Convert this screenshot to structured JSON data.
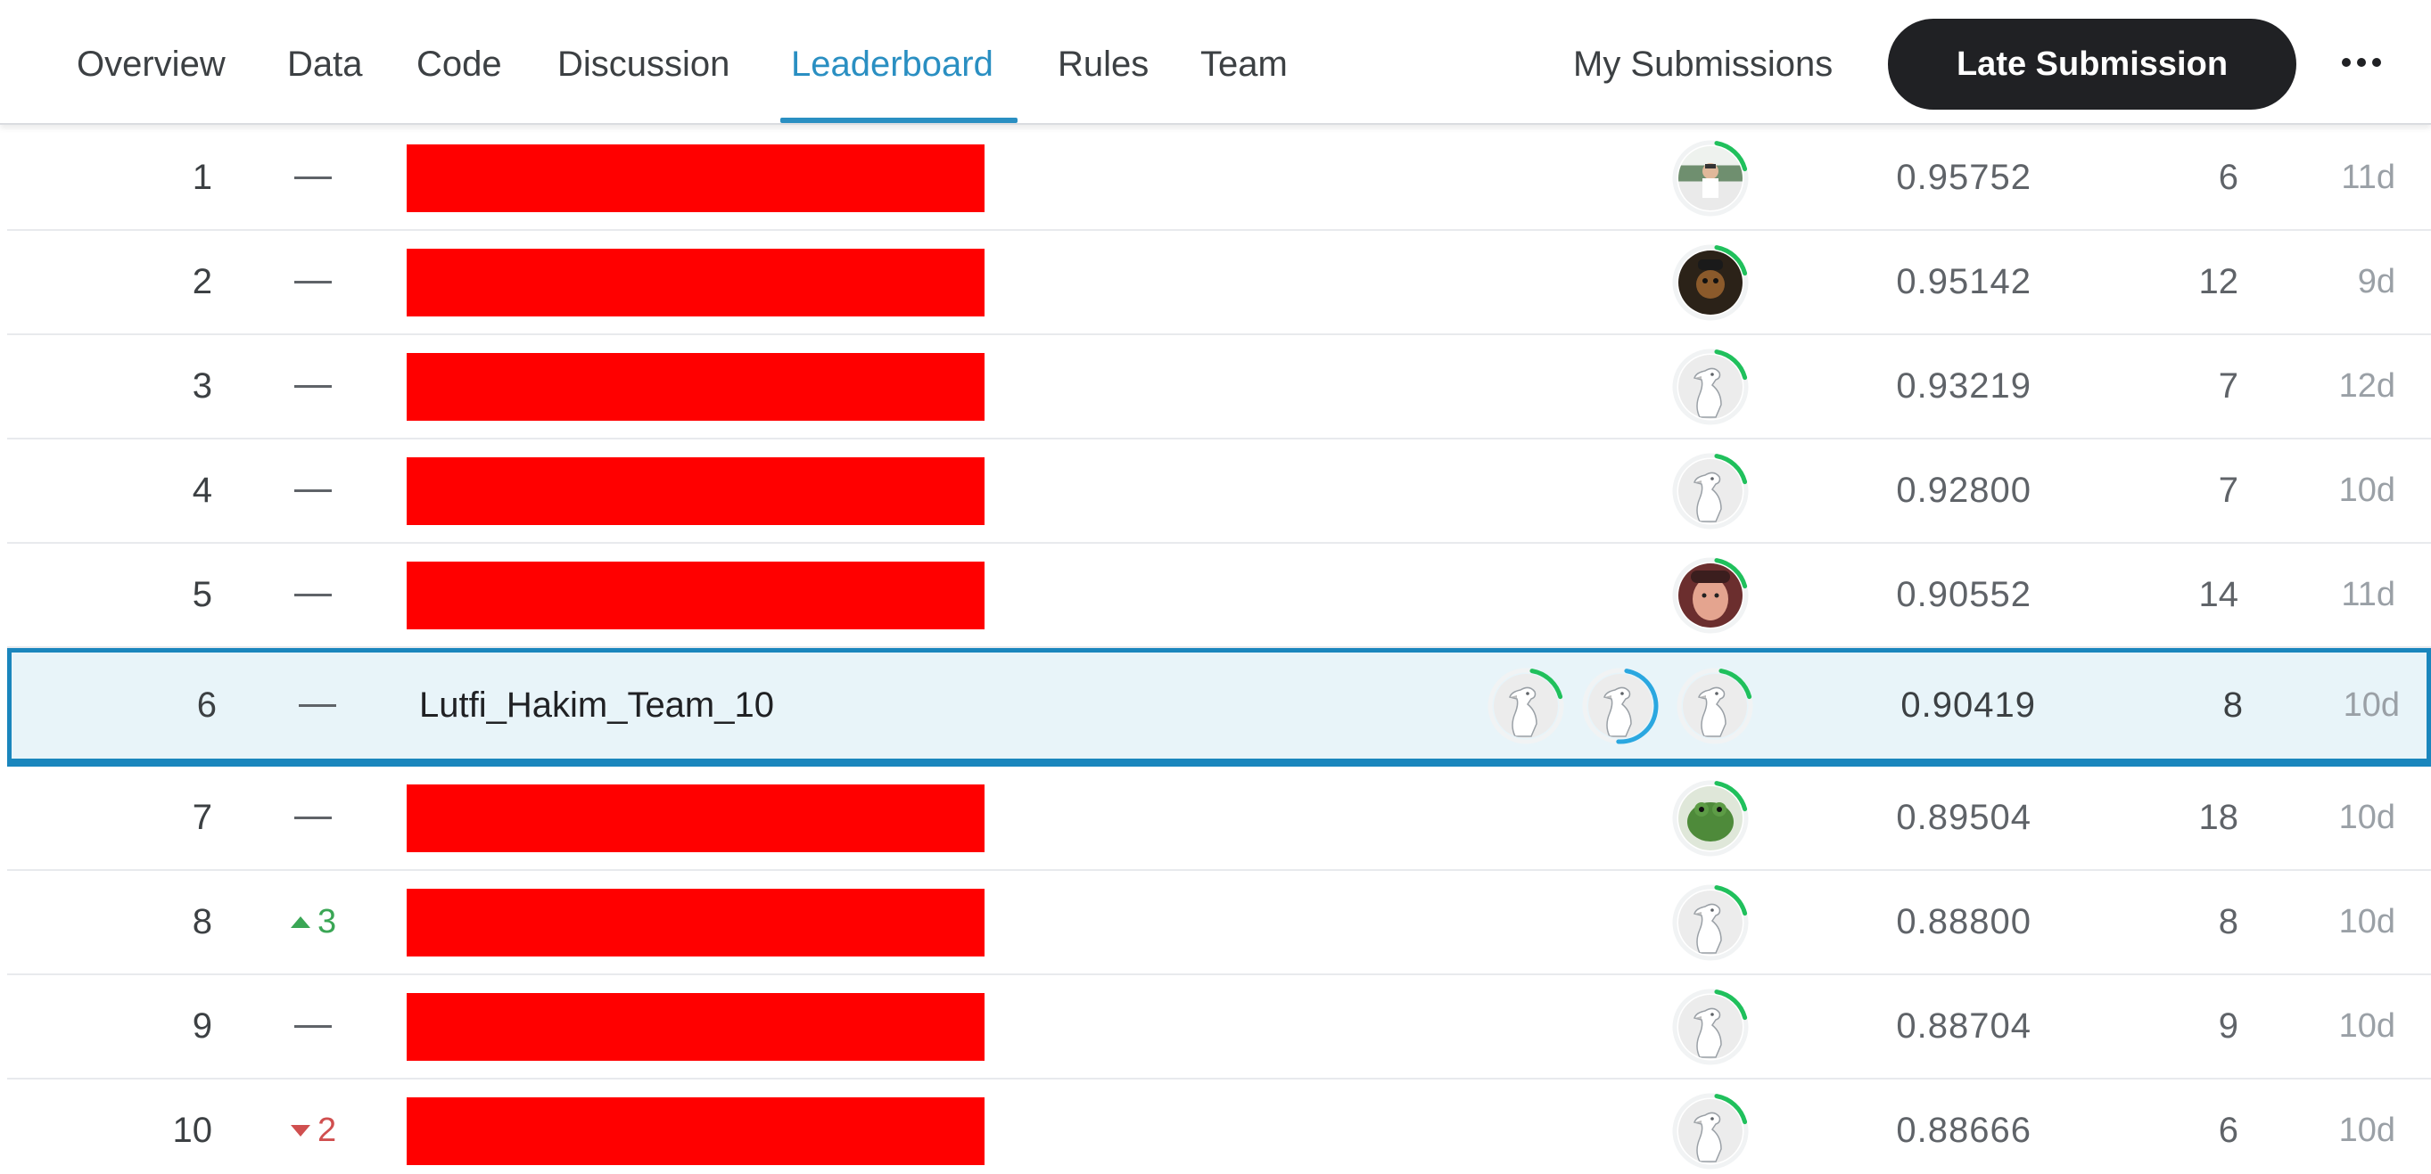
{
  "nav": {
    "tabs": [
      {
        "label": "Overview",
        "active": false
      },
      {
        "label": "Data",
        "active": false
      },
      {
        "label": "Code",
        "active": false
      },
      {
        "label": "Discussion",
        "active": false
      },
      {
        "label": "Leaderboard",
        "active": true
      },
      {
        "label": "Rules",
        "active": false
      },
      {
        "label": "Team",
        "active": false
      }
    ],
    "my_submissions": "My Submissions",
    "late_submission": "Late Submission",
    "more_icon": "more-horizontal-icon"
  },
  "colors": {
    "accent": "#2a8fc2",
    "redaction": "#ff0000",
    "team_row_bg": "#e8f4f9",
    "team_row_border": "#1a86bd",
    "rank_up": "#3aa655",
    "rank_down": "#d04f4f"
  },
  "leaderboard": {
    "rows": [
      {
        "rank": "1",
        "change": "—",
        "change_dir": "none",
        "team": "",
        "redacted": true,
        "avatars": [
          "photo-person"
        ],
        "score": "0.95752",
        "entries": "6",
        "last": "11d"
      },
      {
        "rank": "2",
        "change": "—",
        "change_dir": "none",
        "team": "",
        "redacted": true,
        "avatars": [
          "photo-dark"
        ],
        "score": "0.95142",
        "entries": "12",
        "last": "9d"
      },
      {
        "rank": "3",
        "change": "—",
        "change_dir": "none",
        "team": "",
        "redacted": true,
        "avatars": [
          "default-goose"
        ],
        "score": "0.93219",
        "entries": "7",
        "last": "12d"
      },
      {
        "rank": "4",
        "change": "—",
        "change_dir": "none",
        "team": "",
        "redacted": true,
        "avatars": [
          "default-goose"
        ],
        "score": "0.92800",
        "entries": "7",
        "last": "10d"
      },
      {
        "rank": "5",
        "change": "—",
        "change_dir": "none",
        "team": "",
        "redacted": true,
        "avatars": [
          "photo-face"
        ],
        "score": "0.90552",
        "entries": "14",
        "last": "11d"
      },
      {
        "rank": "6",
        "change": "—",
        "change_dir": "none",
        "team": "Lutfi_Hakim_Team_10",
        "redacted": false,
        "avatars": [
          "default-goose",
          "default-goose",
          "default-goose"
        ],
        "score": "0.90419",
        "entries": "8",
        "last": "10d",
        "is_my_team": true
      },
      {
        "rank": "7",
        "change": "—",
        "change_dir": "none",
        "team": "",
        "redacted": true,
        "avatars": [
          "photo-frog"
        ],
        "score": "0.89504",
        "entries": "18",
        "last": "10d"
      },
      {
        "rank": "8",
        "change": "3",
        "change_dir": "up",
        "team": "",
        "redacted": true,
        "avatars": [
          "default-goose"
        ],
        "score": "0.88800",
        "entries": "8",
        "last": "10d"
      },
      {
        "rank": "9",
        "change": "—",
        "change_dir": "none",
        "team": "",
        "redacted": true,
        "avatars": [
          "default-goose"
        ],
        "score": "0.88704",
        "entries": "9",
        "last": "10d"
      },
      {
        "rank": "10",
        "change": "2",
        "change_dir": "down",
        "team": "",
        "redacted": true,
        "avatars": [
          "default-goose"
        ],
        "score": "0.88666",
        "entries": "6",
        "last": "10d"
      }
    ]
  }
}
